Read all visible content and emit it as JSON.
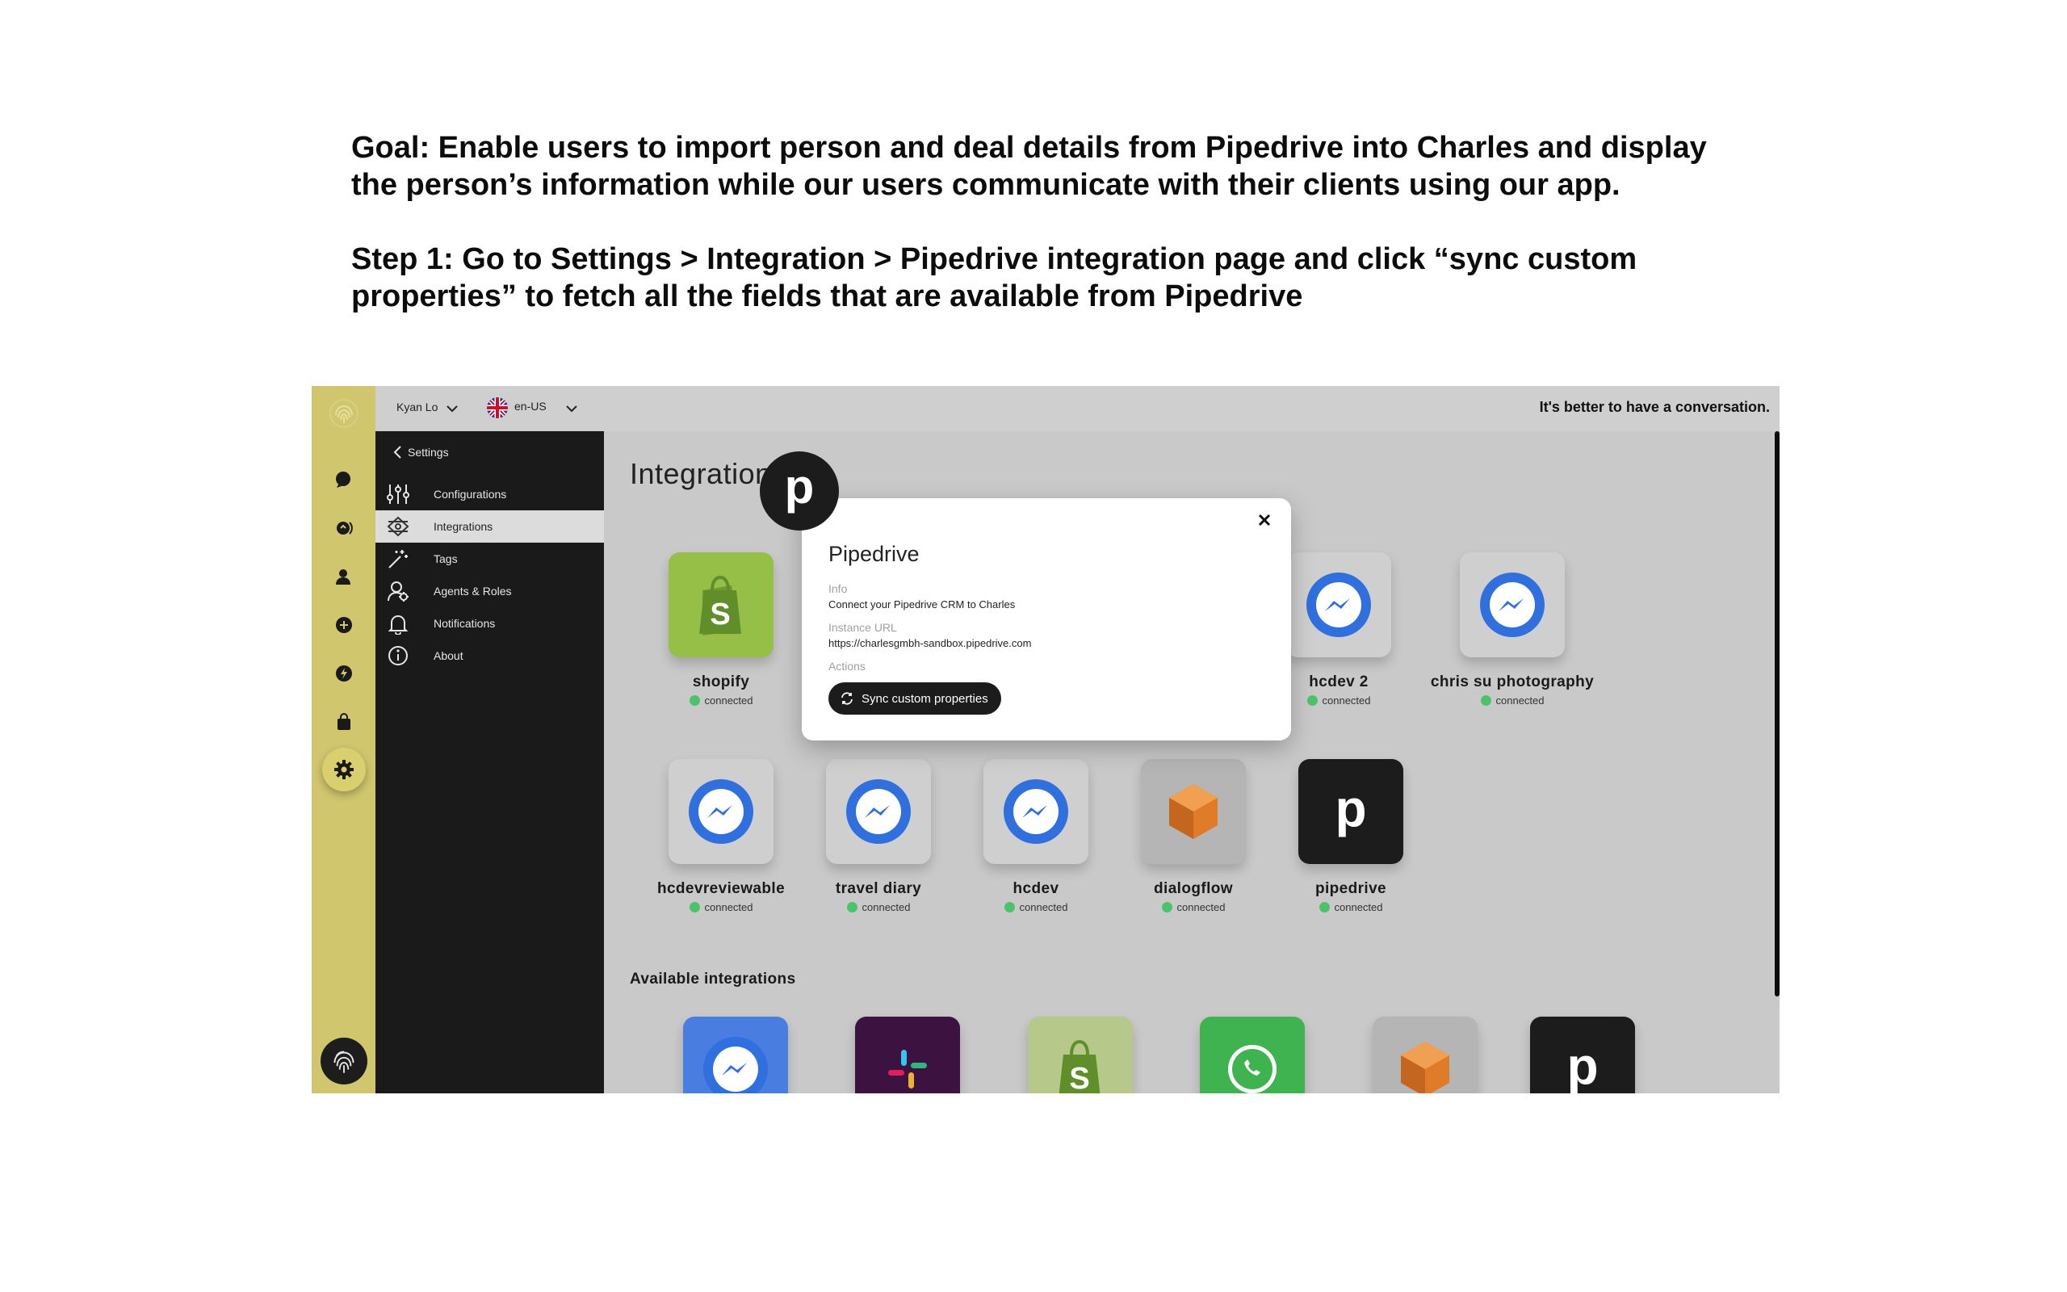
{
  "heading": {
    "goal": "Goal: Enable users to import person and deal details from Pipedrive into Charles and display the person’s information while our users communicate with their clients using our app.",
    "step": "Step 1: Go to Settings > Integration > Pipedrive integration page and click “sync custom properties” to fetch all the fields that are available from Pipedrive"
  },
  "topbar": {
    "user": "Kyan Lo",
    "locale": "en-US",
    "slogan": "It's better to have a conversation."
  },
  "sidebar": {
    "back_label": "Settings",
    "items": [
      {
        "label": "Configurations",
        "icon": "sliders-icon"
      },
      {
        "label": "Integrations",
        "icon": "integrations-icon"
      },
      {
        "label": "Tags",
        "icon": "magic-wand-icon"
      },
      {
        "label": "Agents & Roles",
        "icon": "agents-icon"
      },
      {
        "label": "Notifications",
        "icon": "bell-icon"
      },
      {
        "label": "About",
        "icon": "info-icon"
      }
    ]
  },
  "main": {
    "title": "Integrations",
    "installed": [
      {
        "name": "shopify",
        "status": "connected",
        "icon": "shopify-icon"
      },
      {
        "name": "hcdev 2",
        "status": "connected",
        "icon": "messenger-icon"
      },
      {
        "name": "chris su photography",
        "status": "connected",
        "icon": "messenger-icon"
      },
      {
        "name": "hcdevreviewable",
        "status": "connected",
        "icon": "messenger-icon"
      },
      {
        "name": "travel diary",
        "status": "connected",
        "icon": "messenger-icon"
      },
      {
        "name": "hcdev",
        "status": "connected",
        "icon": "messenger-icon"
      },
      {
        "name": "dialogflow",
        "status": "connected",
        "icon": "dialogflow-icon"
      },
      {
        "name": "pipedrive",
        "status": "connected",
        "icon": "pipedrive-icon"
      }
    ],
    "available_title": "Available integrations",
    "available": [
      "messenger-icon",
      "slack-icon",
      "shopify-icon",
      "whatsapp-icon",
      "dialogflow-icon",
      "pipedrive-icon"
    ]
  },
  "modal": {
    "title": "Pipedrive",
    "info_label": "Info",
    "info_value": "Connect your Pipedrive CRM to Charles",
    "url_label": "Instance URL",
    "url_value": "https://charlesgmbh-sandbox.pipedrive.com",
    "actions_label": "Actions",
    "button_label": "Sync custom properties",
    "badge_letter": "p"
  },
  "colors": {
    "rail": "#cfc66d",
    "sidebar": "#1a1a1a",
    "connected": "#4bc36b",
    "messenger": "#2f6fde",
    "shopify": "#95bf47",
    "pipedrive": "#1c1c1c"
  }
}
